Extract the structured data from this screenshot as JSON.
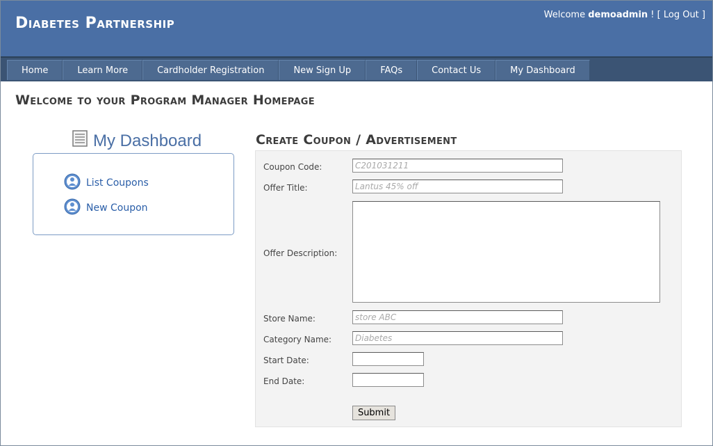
{
  "header": {
    "site_title": "Diabetes Partnership",
    "welcome_prefix": "Welcome ",
    "username": "demoadmin",
    "welcome_sep": " ! [ ",
    "logout_label": "Log Out",
    "welcome_suffix": " ]"
  },
  "nav": {
    "items": [
      "Home",
      "Learn More",
      "Cardholder Registration",
      "New Sign Up",
      "FAQs",
      "Contact Us",
      "My Dashboard"
    ]
  },
  "page_title": "Welcome to your Program Manager Homepage",
  "dashboard": {
    "heading": "My Dashboard",
    "links": [
      "List Coupons",
      "New Coupon"
    ]
  },
  "form": {
    "title": "Create Coupon / Advertisement",
    "coupon_code": {
      "label": "Coupon Code:",
      "value": "C201031211"
    },
    "offer_title": {
      "label": "Offer Title:",
      "value": "Lantus 45% off"
    },
    "offer_description": {
      "label": "Offer Description:",
      "value": ""
    },
    "store_name": {
      "label": "Store Name:",
      "value": "store ABC"
    },
    "category_name": {
      "label": "Category Name:",
      "value": "Diabetes"
    },
    "start_date": {
      "label": "Start Date:",
      "value": ""
    },
    "end_date": {
      "label": "End Date:",
      "value": ""
    },
    "submit_label": "Submit"
  },
  "colors": {
    "header_bg": "#4a6fa5",
    "nav_bg": "#3b5474",
    "link": "#2a5ea8"
  }
}
